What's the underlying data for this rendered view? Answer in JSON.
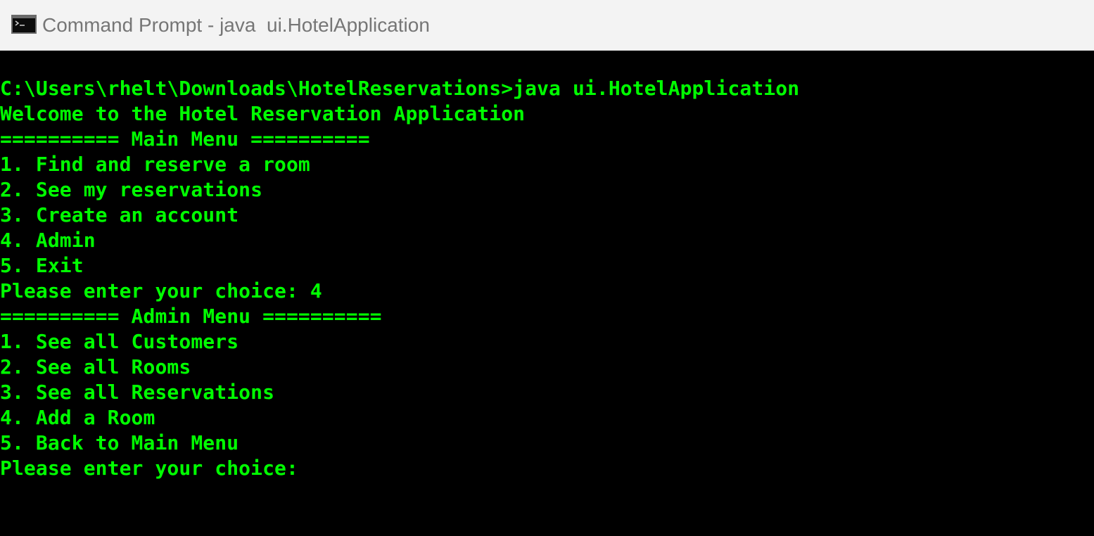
{
  "window": {
    "title": "Command Prompt - java  ui.HotelApplication",
    "icon": "command-prompt-icon"
  },
  "colors": {
    "console_text": "#00ff00",
    "console_background": "#000000",
    "titlebar_background": "#f3f3f3",
    "title_text": "#767676"
  },
  "console": {
    "lines": [
      "C:\\Users\\rhelt\\Downloads\\HotelReservations>java ui.HotelApplication",
      "Welcome to the Hotel Reservation Application",
      "========== Main Menu ==========",
      "1. Find and reserve a room",
      "2. See my reservations",
      "3. Create an account",
      "4. Admin",
      "5. Exit",
      "Please enter your choice: 4",
      "========== Admin Menu ==========",
      "1. See all Customers",
      "2. See all Rooms",
      "3. See all Reservations",
      "4. Add a Room",
      "5. Back to Main Menu",
      "Please enter your choice:"
    ]
  }
}
